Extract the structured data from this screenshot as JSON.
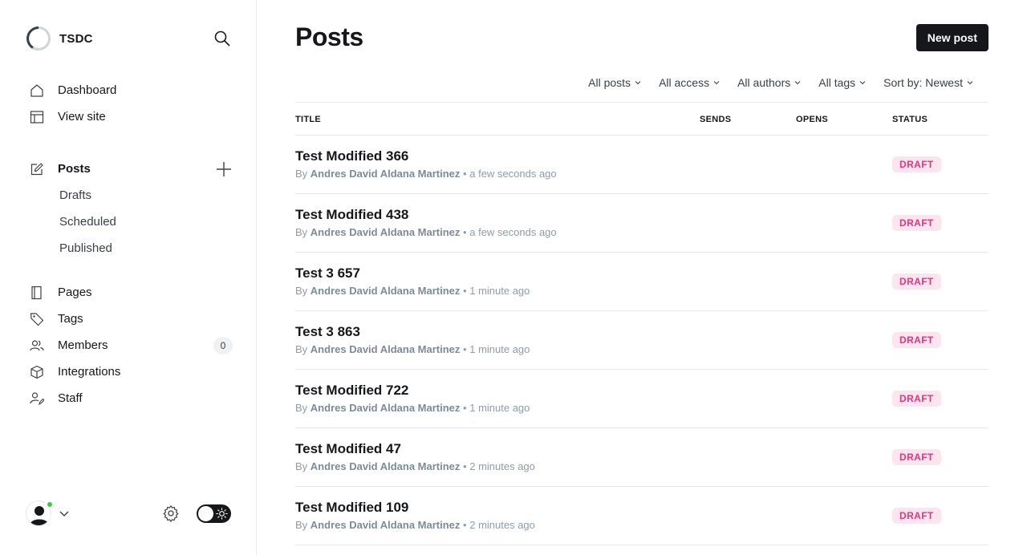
{
  "sidebar": {
    "brand": {
      "name": "TSDC",
      "logo_icon": "ring-logo-icon"
    },
    "search_icon": "search-icon",
    "nav_top": [
      {
        "label": "Dashboard",
        "icon": "home-icon"
      },
      {
        "label": "View site",
        "icon": "layout-icon"
      }
    ],
    "posts": {
      "label": "Posts",
      "icon": "edit-icon",
      "add_icon": "plus-icon",
      "subitems": [
        {
          "label": "Drafts"
        },
        {
          "label": "Scheduled"
        },
        {
          "label": "Published"
        }
      ]
    },
    "nav_bottom": [
      {
        "label": "Pages",
        "icon": "page-icon"
      },
      {
        "label": "Tags",
        "icon": "tag-icon"
      },
      {
        "label": "Members",
        "icon": "members-icon",
        "count": "0"
      },
      {
        "label": "Integrations",
        "icon": "box-icon"
      },
      {
        "label": "Staff",
        "icon": "staff-icon"
      }
    ],
    "footer": {
      "avatar_icon": "user-avatar-icon",
      "online": true,
      "settings_icon": "gear-icon",
      "theme_toggle_icon": "sun-icon"
    }
  },
  "main": {
    "title": "Posts",
    "new_post_label": "New post",
    "filters": [
      {
        "label": "All posts"
      },
      {
        "label": "All access"
      },
      {
        "label": "All authors"
      },
      {
        "label": "All tags"
      },
      {
        "label": "Sort by: Newest"
      }
    ],
    "columns": {
      "title": "TITLE",
      "sends": "SENDS",
      "opens": "OPENS",
      "status": "STATUS"
    },
    "posts": [
      {
        "title": "Test Modified 366",
        "by": "By",
        "author": "Andres David Aldana Martinez",
        "sep": "•",
        "time": "a few seconds ago",
        "status": "DRAFT"
      },
      {
        "title": "Test Modified 438",
        "by": "By",
        "author": "Andres David Aldana Martinez",
        "sep": "•",
        "time": "a few seconds ago",
        "status": "DRAFT"
      },
      {
        "title": "Test 3 657",
        "by": "By",
        "author": "Andres David Aldana Martinez",
        "sep": "•",
        "time": "1 minute ago",
        "status": "DRAFT"
      },
      {
        "title": "Test 3 863",
        "by": "By",
        "author": "Andres David Aldana Martinez",
        "sep": "•",
        "time": "1 minute ago",
        "status": "DRAFT"
      },
      {
        "title": "Test Modified 722",
        "by": "By",
        "author": "Andres David Aldana Martinez",
        "sep": "•",
        "time": "1 minute ago",
        "status": "DRAFT"
      },
      {
        "title": "Test Modified 47",
        "by": "By",
        "author": "Andres David Aldana Martinez",
        "sep": "•",
        "time": "2 minutes ago",
        "status": "DRAFT"
      },
      {
        "title": "Test Modified 109",
        "by": "By",
        "author": "Andres David Aldana Martinez",
        "sep": "•",
        "time": "2 minutes ago",
        "status": "DRAFT"
      }
    ]
  },
  "colors": {
    "accent_dark": "#15171a",
    "draft_bg": "#fde5f0",
    "draft_text": "#e5357e",
    "online": "#30cf43",
    "muted": "#8e9cac"
  }
}
